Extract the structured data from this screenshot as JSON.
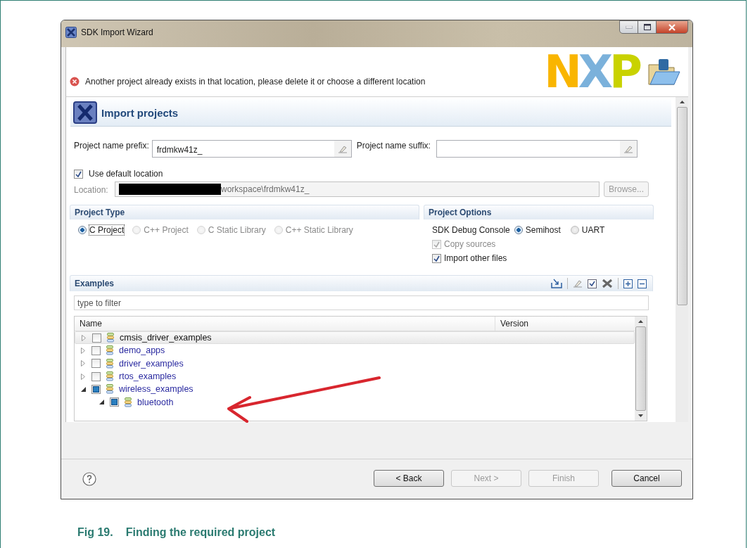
{
  "window": {
    "title": "SDK Import Wizard"
  },
  "message": {
    "kind": "error",
    "text": "Another project already exists in that location, please delete it or choose a different location"
  },
  "logo": "NXP",
  "page_title": "Import projects",
  "prefix": {
    "label": "Project name prefix:",
    "value": "frdmkw41z_"
  },
  "suffix": {
    "label": "Project name suffix:"
  },
  "use_default_location": {
    "label": "Use default location",
    "checked": true
  },
  "location": {
    "label": "Location:",
    "value": "workspace\\frdmkw41z_",
    "redacted": true,
    "disabled": true
  },
  "browse": {
    "label": "Browse...",
    "disabled": true
  },
  "project_type": {
    "title": "Project Type",
    "options": [
      {
        "label": "C Project",
        "selected": true,
        "disabled": false
      },
      {
        "label": "C++ Project",
        "selected": false,
        "disabled": true
      },
      {
        "label": "C Static Library",
        "selected": false,
        "disabled": true
      },
      {
        "label": "C++ Static Library",
        "selected": false,
        "disabled": true
      }
    ]
  },
  "project_options": {
    "title": "Project Options",
    "debug_console": {
      "label": "SDK Debug Console",
      "options": [
        {
          "label": "Semihost",
          "selected": true
        },
        {
          "label": "UART",
          "selected": false
        }
      ]
    },
    "checkboxes": [
      {
        "label": "Copy sources",
        "checked": true,
        "disabled": true
      },
      {
        "label": "Import other files",
        "checked": true,
        "disabled": false
      }
    ]
  },
  "examples": {
    "title": "Examples",
    "filter": {
      "placeholder": "type to filter"
    },
    "columns": [
      "Name",
      "Version"
    ],
    "rows": [
      {
        "name": "cmsis_driver_examples",
        "expanded": false,
        "partially_checked": false,
        "selected": true
      },
      {
        "name": "demo_apps",
        "expanded": false,
        "partially_checked": false,
        "selected": false
      },
      {
        "name": "driver_examples",
        "expanded": false,
        "partially_checked": false,
        "selected": false
      },
      {
        "name": "rtos_examples",
        "expanded": false,
        "partially_checked": false,
        "selected": false
      },
      {
        "name": "wireless_examples",
        "expanded": true,
        "partially_checked": true,
        "selected": false,
        "children": [
          {
            "name": "bluetooth",
            "expanded": true,
            "partially_checked": true,
            "selected": false
          }
        ]
      }
    ]
  },
  "buttons": [
    {
      "label": "< Back",
      "disabled": false
    },
    {
      "label": "Next >",
      "disabled": true
    },
    {
      "label": "Finish",
      "disabled": true
    },
    {
      "label": "Cancel",
      "disabled": false
    }
  ],
  "caption": {
    "number": "Fig 19.",
    "text": "Finding the required project"
  }
}
